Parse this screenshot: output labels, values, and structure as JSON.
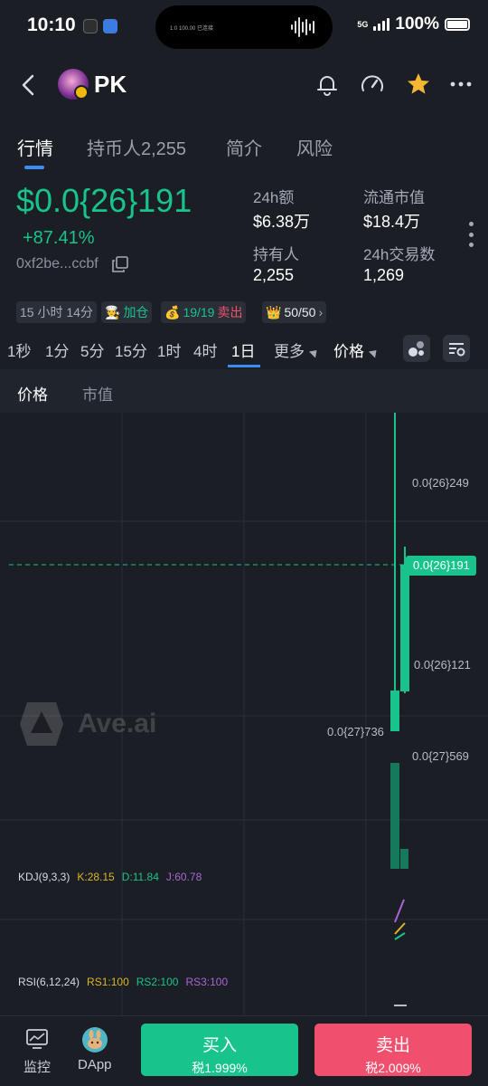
{
  "status_bar": {
    "time": "10:10",
    "network": "5G",
    "battery": "100%",
    "island_text": "1:0 100.00 已连接"
  },
  "header": {
    "token_name": "PK",
    "back_icon": "chevron-left-icon",
    "bell_icon": "bell-icon",
    "speed_icon": "gauge-icon",
    "star_icon": "star-icon",
    "more_icon": "ellipsis-icon",
    "star_color": "#f5b731"
  },
  "tabs": [
    {
      "label": "行情",
      "active": true
    },
    {
      "label": "持币人2,255",
      "active": false
    },
    {
      "label": "简介",
      "active": false
    },
    {
      "label": "风险",
      "active": false
    }
  ],
  "price": {
    "value": "$0.0{26}191",
    "change": "+87.41%",
    "address": "0xf2be...ccbf",
    "up_color": "#19c48c"
  },
  "stats": {
    "volume_label": "24h额",
    "volume_value": "$6.38万",
    "mcap_label": "流通市值",
    "mcap_value": "$18.4万",
    "holders_label": "持有人",
    "holders_value": "2,255",
    "txns_label": "24h交易数",
    "txns_value": "1,269"
  },
  "chips": {
    "age": "15 小时 14分",
    "add_label": "加仓",
    "sell_count": "19/19",
    "sell_label": "卖出",
    "score": "50/50"
  },
  "intervals": [
    "1秒",
    "1分",
    "5分",
    "15分",
    "1时",
    "4时",
    "1日"
  ],
  "more_label": "更多",
  "price_select": "价格",
  "subtabs": {
    "price": "价格",
    "mcap": "市值"
  },
  "chart": {
    "watermark": "Ave.ai",
    "labels": {
      "high": "0.0{26}249",
      "current": "0.0{26}191",
      "mid": "0.0{26}121",
      "low_left": "0.0{27}736",
      "bottom": "0.0{27}569"
    },
    "kdj": {
      "name": "KDJ(9,3,3)",
      "k": "K:28.15",
      "d": "D:11.84",
      "j": "J:60.78"
    },
    "rsi": {
      "name": "RSI(6,12,24)",
      "rsi1": "RS1:100",
      "rsi2": "RS2:100",
      "rsi3": "RS3:100"
    }
  },
  "bottom": {
    "monitor_label": "监控",
    "dapp_label": "DApp",
    "buy_label": "买入",
    "buy_tax": "税1.999%",
    "sell_label": "卖出",
    "sell_tax": "税2.009%",
    "buy_color": "#19c48c",
    "sell_color": "#f0506e"
  }
}
